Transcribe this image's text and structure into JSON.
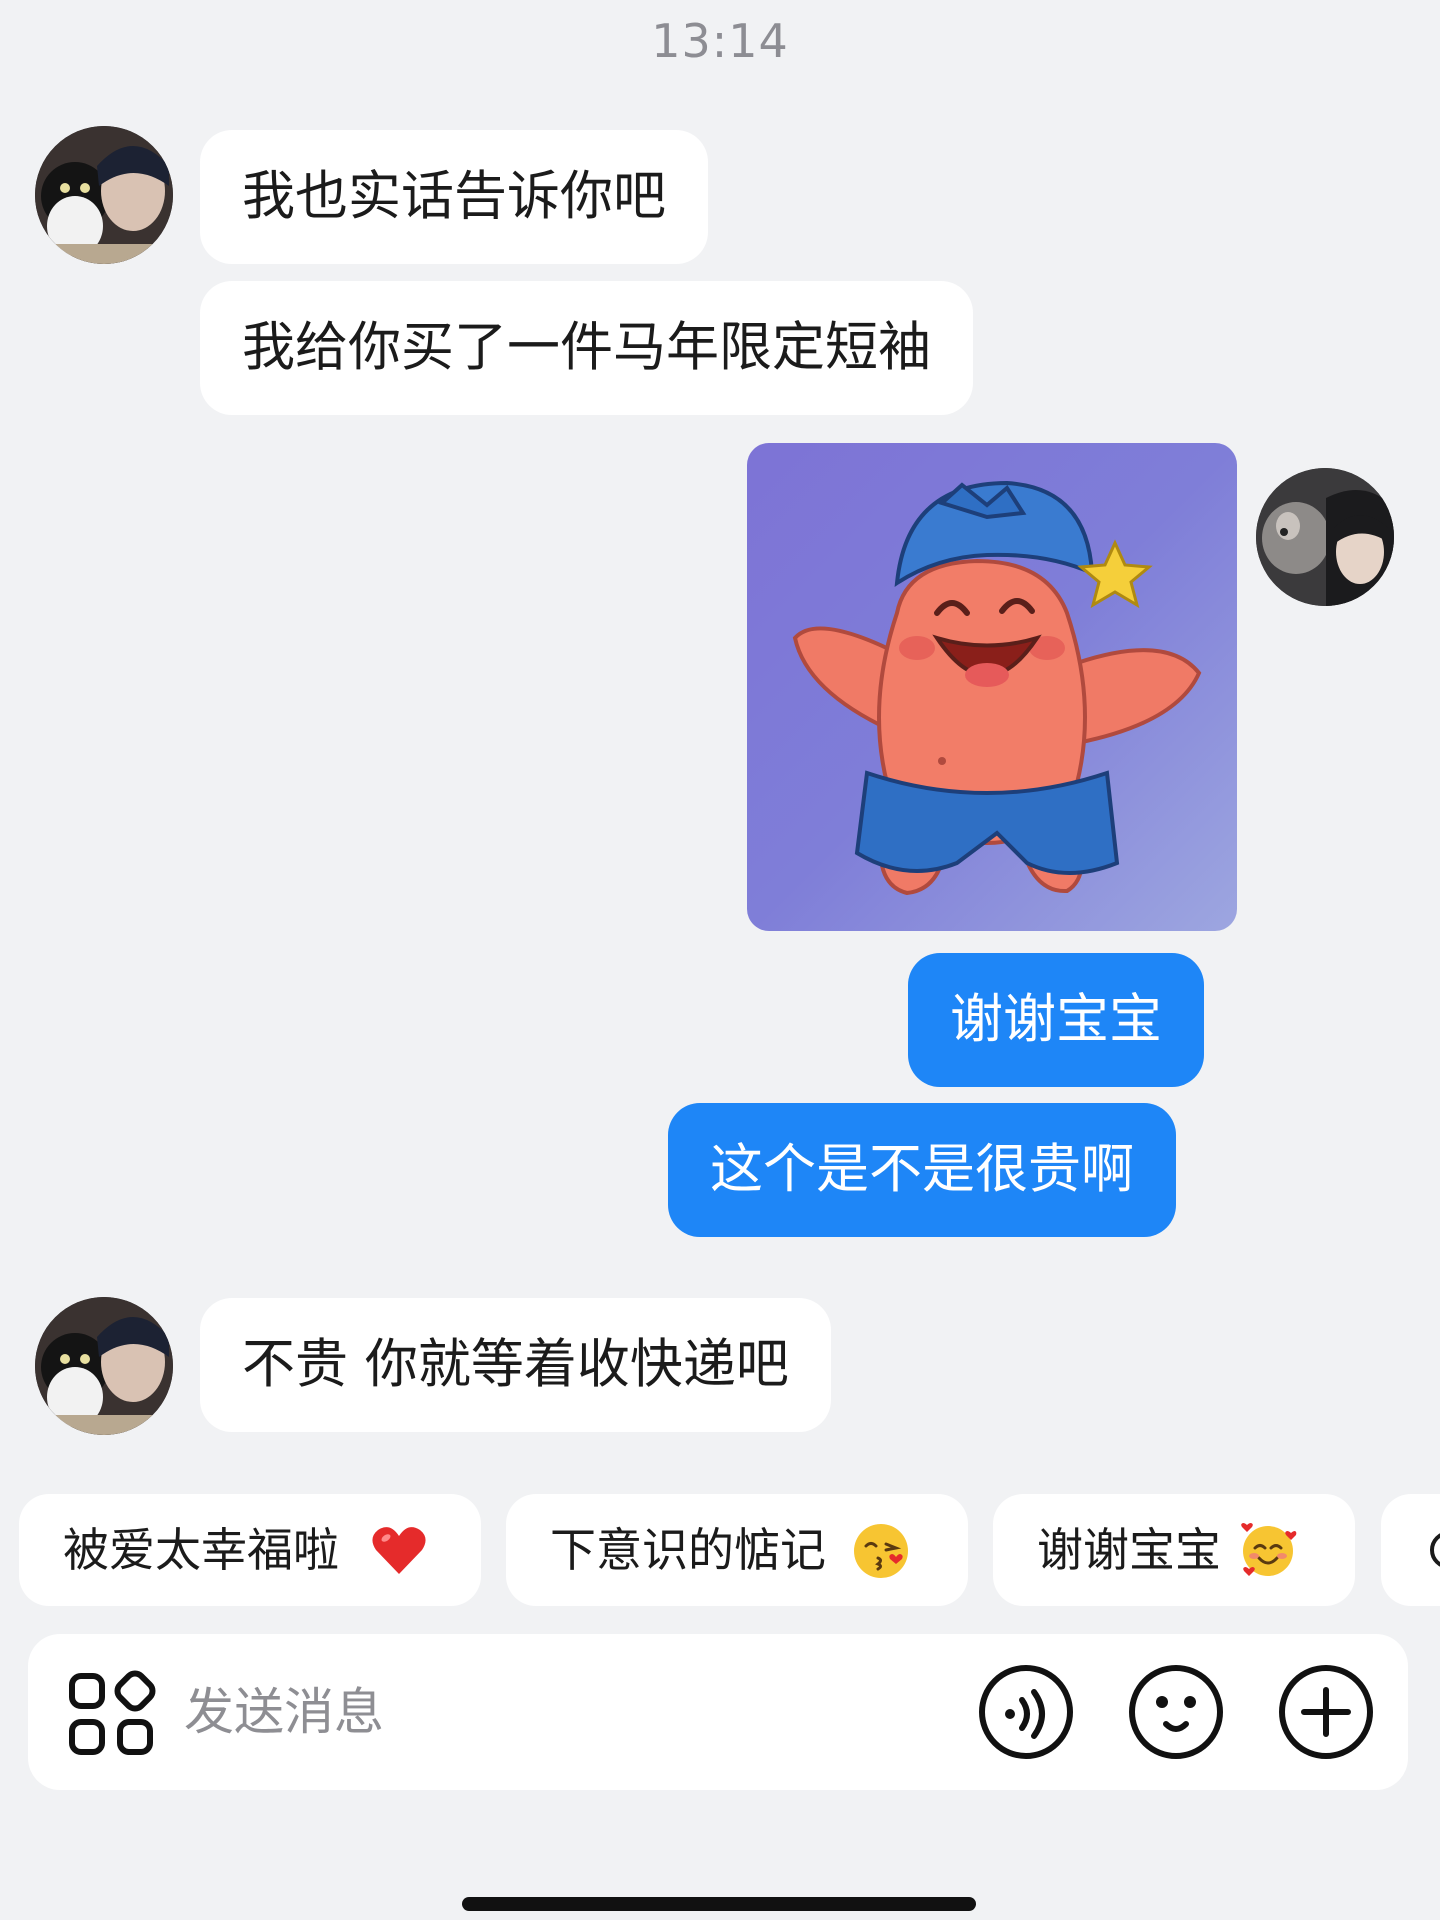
{
  "status": {
    "time": "13:14"
  },
  "messages": [
    {
      "side": "incoming",
      "text": "我也实话告诉你吧"
    },
    {
      "side": "incoming",
      "text": "我给你买了一件马年限定短袖"
    },
    {
      "side": "outgoing",
      "type": "sticker",
      "sticker": "patrick-star-blue-hat-sticker"
    },
    {
      "side": "outgoing",
      "text": "谢谢宝宝"
    },
    {
      "side": "outgoing",
      "text": "这个是不是很贵啊"
    },
    {
      "side": "incoming",
      "text": "不贵 你就等着收快递吧"
    }
  ],
  "suggestions": [
    {
      "label": "被爱太幸福啦",
      "emoji": "red-heart-icon"
    },
    {
      "label": "下意识的惦记",
      "emoji": "kissing-face-icon"
    },
    {
      "label": "谢谢宝宝",
      "emoji": "smiling-face-with-hearts-icon"
    }
  ],
  "composer": {
    "placeholder": "发送消息",
    "icons": [
      "apps-icon",
      "voice-icon",
      "emoji-icon",
      "add-icon"
    ]
  },
  "colors": {
    "background": "#f1f2f4",
    "incoming_bubble": "#ffffff",
    "outgoing_bubble": "#1e86f7",
    "timestamp": "#8d8d93"
  }
}
